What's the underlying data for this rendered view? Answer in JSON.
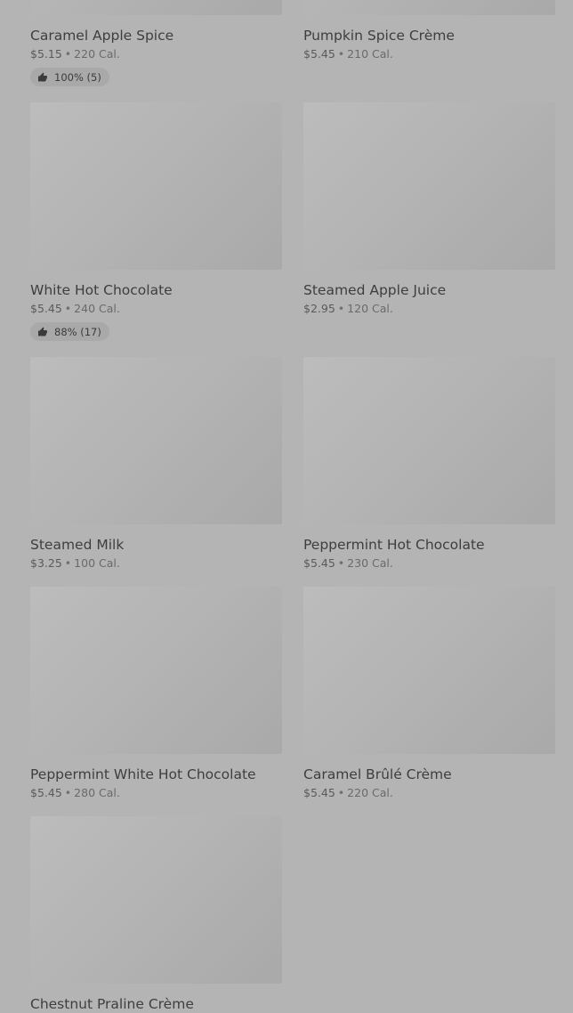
{
  "products": [
    {
      "name": "Caramel Apple Spice",
      "price": "$5.15",
      "separator": "•",
      "calories": "220 Cal.",
      "rating": "100% (5)"
    },
    {
      "name": "Pumpkin Spice Crème",
      "price": "$5.45",
      "separator": "•",
      "calories": "210 Cal.",
      "rating": null
    },
    {
      "name": "White Hot Chocolate",
      "price": "$5.45",
      "separator": "•",
      "calories": "240 Cal.",
      "rating": "88% (17)"
    },
    {
      "name": "Steamed Apple Juice",
      "price": "$2.95",
      "separator": "•",
      "calories": "120 Cal.",
      "rating": null
    },
    {
      "name": "Steamed Milk",
      "price": "$3.25",
      "separator": "•",
      "calories": "100 Cal.",
      "rating": null
    },
    {
      "name": "Peppermint Hot Chocolate",
      "price": "$5.45",
      "separator": "•",
      "calories": "230 Cal.",
      "rating": null
    },
    {
      "name": "Peppermint White Hot Chocolate",
      "price": "$5.45",
      "separator": "•",
      "calories": "280 Cal.",
      "rating": null
    },
    {
      "name": "Caramel Brûlé Crème",
      "price": "$5.45",
      "separator": "•",
      "calories": "220 Cal.",
      "rating": null
    },
    {
      "name": "Chestnut Praline Crème",
      "price": null,
      "separator": null,
      "calories": null,
      "rating": null
    }
  ],
  "icons": {
    "rating": "thumbs-up-icon"
  },
  "colors": {
    "background": "#b4b4b4",
    "text": "#3e3e3e",
    "chip": "#a9a9a9"
  }
}
